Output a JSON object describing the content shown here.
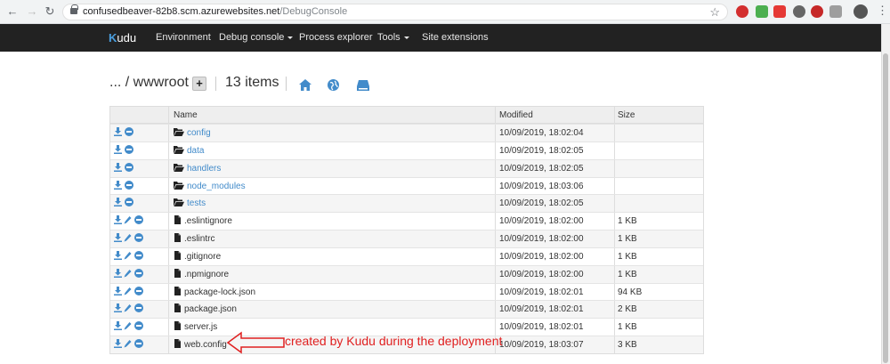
{
  "browser": {
    "url_host": "confusedbeaver-82b8.scm.azurewebsites.net",
    "url_path": "/DebugConsole"
  },
  "navbar": {
    "brand_k": "K",
    "brand_rest": "udu",
    "items": [
      {
        "label": "Environment"
      },
      {
        "label": "Debug console"
      },
      {
        "label": "Process explorer"
      },
      {
        "label": "Tools"
      },
      {
        "label": "Site extensions"
      }
    ]
  },
  "breadcrumb": {
    "path": "... / wwwroot",
    "add_label": "+",
    "item_count": "13 items"
  },
  "table": {
    "headers": {
      "name": "Name",
      "modified": "Modified",
      "size": "Size"
    },
    "rows": [
      {
        "name": "config",
        "type": "folder",
        "modified": "10/09/2019, 18:02:04",
        "size": ""
      },
      {
        "name": "data",
        "type": "folder",
        "modified": "10/09/2019, 18:02:05",
        "size": ""
      },
      {
        "name": "handlers",
        "type": "folder",
        "modified": "10/09/2019, 18:02:05",
        "size": ""
      },
      {
        "name": "node_modules",
        "type": "folder",
        "modified": "10/09/2019, 18:03:06",
        "size": ""
      },
      {
        "name": "tests",
        "type": "folder",
        "modified": "10/09/2019, 18:02:05",
        "size": ""
      },
      {
        "name": ".eslintignore",
        "type": "file",
        "modified": "10/09/2019, 18:02:00",
        "size": "1 KB"
      },
      {
        "name": ".eslintrc",
        "type": "file",
        "modified": "10/09/2019, 18:02:00",
        "size": "1 KB"
      },
      {
        "name": ".gitignore",
        "type": "file",
        "modified": "10/09/2019, 18:02:00",
        "size": "1 KB"
      },
      {
        "name": ".npmignore",
        "type": "file",
        "modified": "10/09/2019, 18:02:00",
        "size": "1 KB"
      },
      {
        "name": "package-lock.json",
        "type": "file",
        "modified": "10/09/2019, 18:02:01",
        "size": "94 KB"
      },
      {
        "name": "package.json",
        "type": "file",
        "modified": "10/09/2019, 18:02:01",
        "size": "2 KB"
      },
      {
        "name": "server.js",
        "type": "file",
        "modified": "10/09/2019, 18:02:01",
        "size": "1 KB"
      },
      {
        "name": "web.config",
        "type": "file",
        "modified": "10/09/2019, 18:03:07",
        "size": "3 KB"
      }
    ]
  },
  "annotation": {
    "text": "created by Kudu during the deployment",
    "color": "#e02020"
  },
  "colors": {
    "accent": "#428bca",
    "navbar_bg": "#222222"
  }
}
